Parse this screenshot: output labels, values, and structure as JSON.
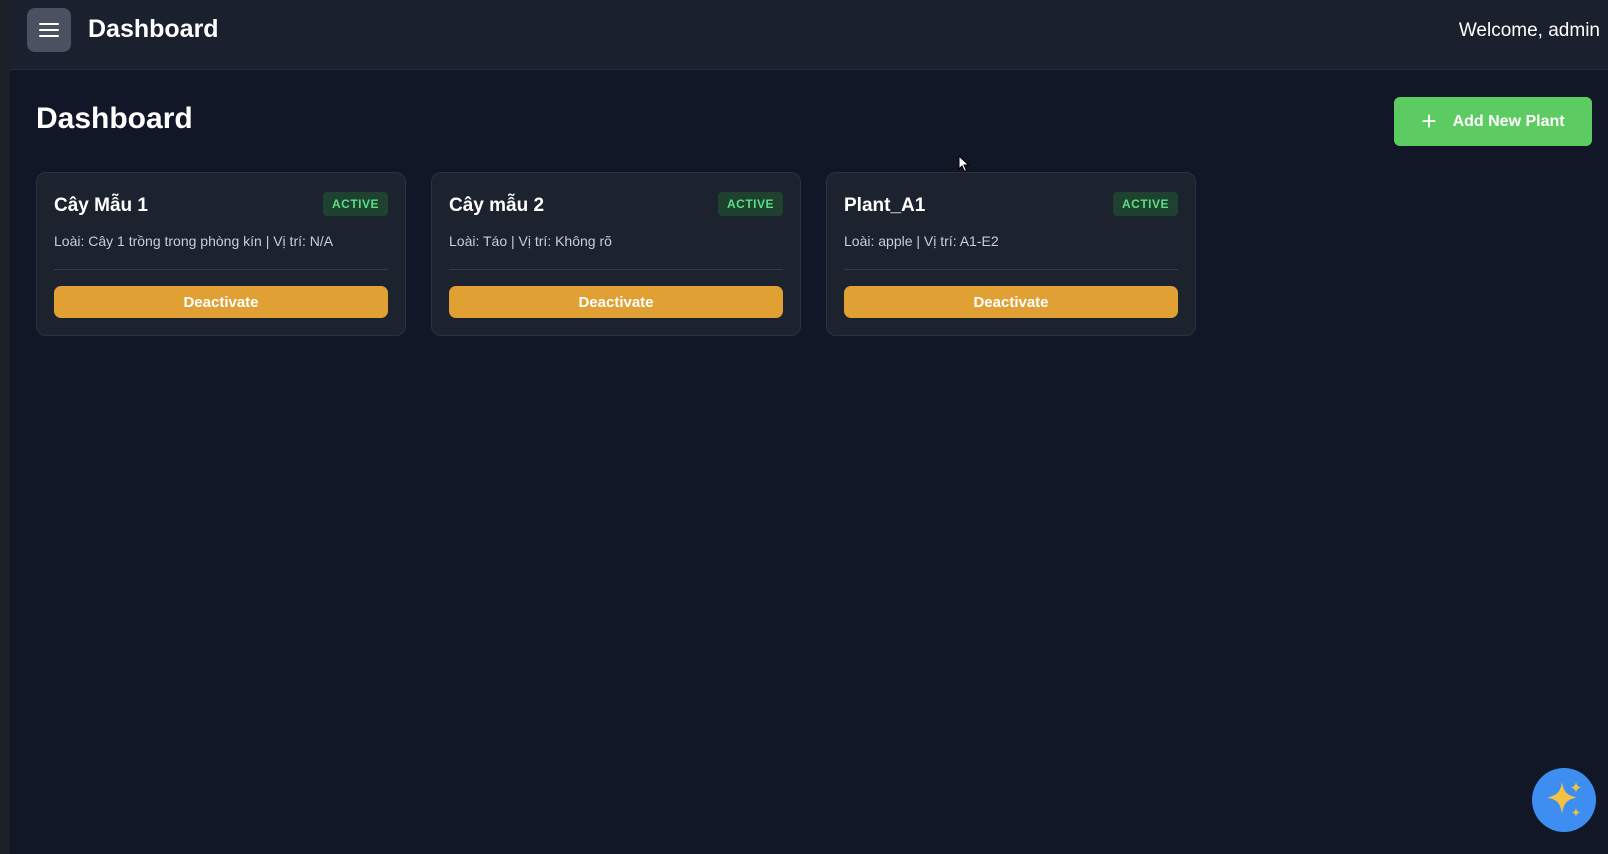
{
  "header": {
    "title": "Dashboard",
    "welcome": "Welcome, admin",
    "menu_icon": "hamburger-menu-icon"
  },
  "main": {
    "title": "Dashboard",
    "add_button_label": "Add New Plant",
    "add_button_icon": "plus-icon"
  },
  "plants": [
    {
      "name": "Cây Mẫu 1",
      "status": "ACTIVE",
      "meta": "Loài: Cây 1 trồng trong phòng kín | Vị trí: N/A",
      "action": "Deactivate"
    },
    {
      "name": "Cây mẫu 2",
      "status": "ACTIVE",
      "meta": "Loài: Táo | Vị trí: Không rõ",
      "action": "Deactivate"
    },
    {
      "name": "Plant_A1",
      "status": "ACTIVE",
      "meta": "Loài: apple | Vị trí: A1-E2",
      "action": "Deactivate"
    }
  ],
  "assistant": {
    "icon": "sparkle-icon"
  },
  "colors": {
    "background": "#111726",
    "topbar": "#1a202d",
    "card": "#1c222e",
    "accent_green": "#5ccc62",
    "deactivate_orange": "#e0a033",
    "badge_text": "#5ddc82",
    "assistant_blue": "#3d8ef0",
    "sparkle": "#f5c242"
  }
}
